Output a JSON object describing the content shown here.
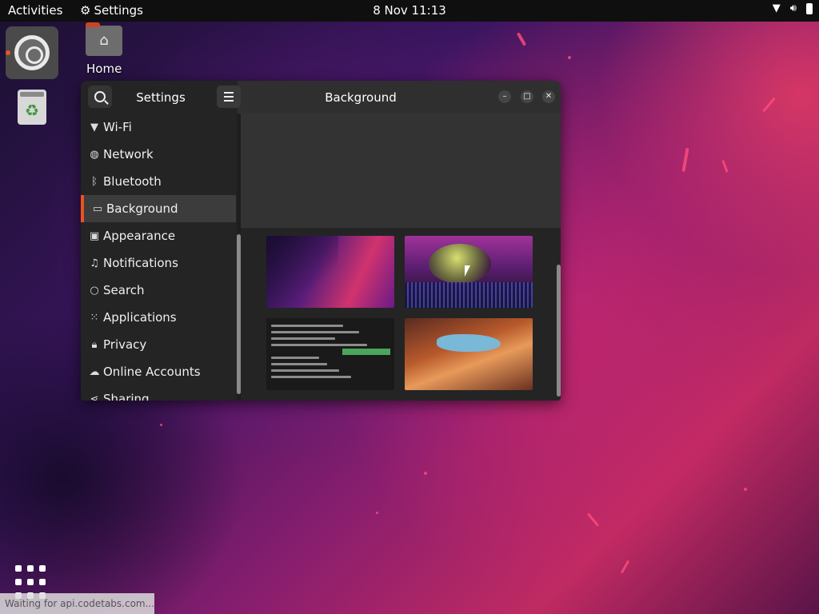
{
  "topbar": {
    "activities": "Activities",
    "app_name": "Settings",
    "clock": "8 Nov 11:13"
  },
  "desktop": {
    "home_label": "Home"
  },
  "window": {
    "sidebar_title": "Settings",
    "title": "Background",
    "sidebar_items": [
      {
        "label": "Wi-Fi",
        "icon": "wifi-icon"
      },
      {
        "label": "Network",
        "icon": "network-icon"
      },
      {
        "label": "Bluetooth",
        "icon": "bluetooth-icon"
      },
      {
        "label": "Background",
        "icon": "display-icon",
        "active": true
      },
      {
        "label": "Appearance",
        "icon": "appearance-icon"
      },
      {
        "label": "Notifications",
        "icon": "bell-icon"
      },
      {
        "label": "Search",
        "icon": "search-icon"
      },
      {
        "label": "Applications",
        "icon": "grid-icon"
      },
      {
        "label": "Privacy",
        "icon": "lock-icon"
      },
      {
        "label": "Online Accounts",
        "icon": "cloud-icon"
      },
      {
        "label": "Sharing",
        "icon": "share-icon"
      }
    ]
  },
  "statusbar": {
    "text": "Waiting for api.codetabs.com..."
  },
  "colors": {
    "accent": "#e95420"
  }
}
